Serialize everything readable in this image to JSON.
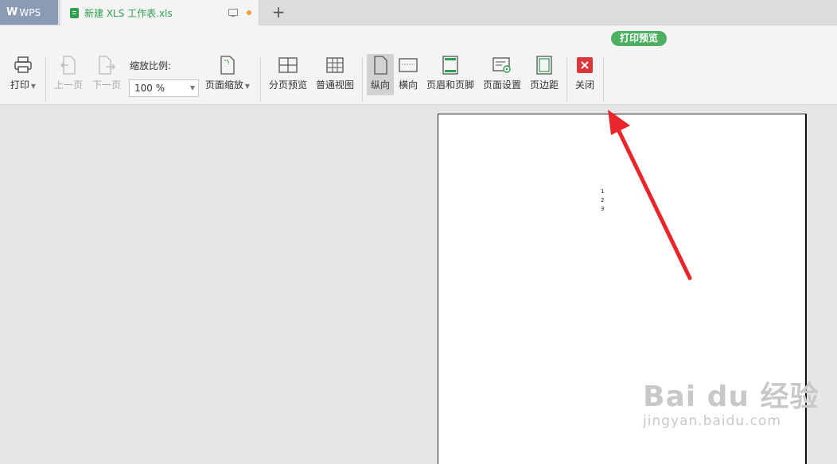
{
  "tabs": {
    "app_label": "WPS",
    "doc_title": "新建 XLS 工作表.xls",
    "new_tab": "+"
  },
  "toolbar": {
    "badge": "打印预览",
    "print": "打印",
    "prev_page": "上一页",
    "next_page": "下一页",
    "zoom_label": "缩放比例:",
    "zoom_value": "100 %",
    "page_scale": "页面缩放",
    "page_break_preview": "分页预览",
    "normal_view": "普通视图",
    "portrait": "纵向",
    "landscape": "横向",
    "header_footer": "页眉和页脚",
    "page_setup": "页面设置",
    "margins": "页边距",
    "close": "关闭"
  },
  "page": {
    "cells": [
      "1",
      "2",
      "3"
    ]
  },
  "watermark": {
    "brand": "Bai du 经验",
    "url": "jingyan.baidu.com"
  },
  "colors": {
    "accent_green": "#4caf62",
    "close_red": "#d9383a",
    "arrow_red": "#e8262b"
  }
}
